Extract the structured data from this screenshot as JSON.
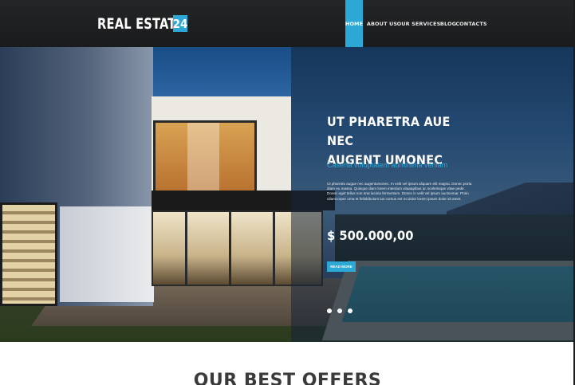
{
  "header": {
    "logo_text": "REAL ESTATE",
    "logo_badge": "24",
    "nav": [
      {
        "label": "HOME",
        "active": true
      },
      {
        "label": "ABOUT US",
        "active": false
      },
      {
        "label": "OUR SERVICES",
        "active": false
      },
      {
        "label": "BLOG",
        "active": false
      },
      {
        "label": "CONTACTS",
        "active": false
      }
    ]
  },
  "hero": {
    "title": "UT PHARETRA AUE NEC\nAUGENT UMONEC",
    "subtitle": "Caserta voluptatem adminima veniam",
    "body": "Ut pharetra augue nec augentumonec. In velit vel ipsum aliquam elit magna. Donec porta diam eu massa. Quisque diam lorem interdum vitaaapibus ac scelerisque vitae pede. Donec eget tellus non erat lacinia fermentum. Donec in velit vel ipsum auctovmar. Proin ullamcorper urna et felisbibulum ius cursus est mi dolor lorem ipsum dolor sit amet.",
    "price": "$ 500.000,00",
    "button_label": "READ MORE",
    "slide_count": 3
  },
  "section": {
    "title": "OUR BEST OFFERS"
  },
  "colors": {
    "accent": "#2ba8d6",
    "header_bg": "#1e1f20"
  }
}
